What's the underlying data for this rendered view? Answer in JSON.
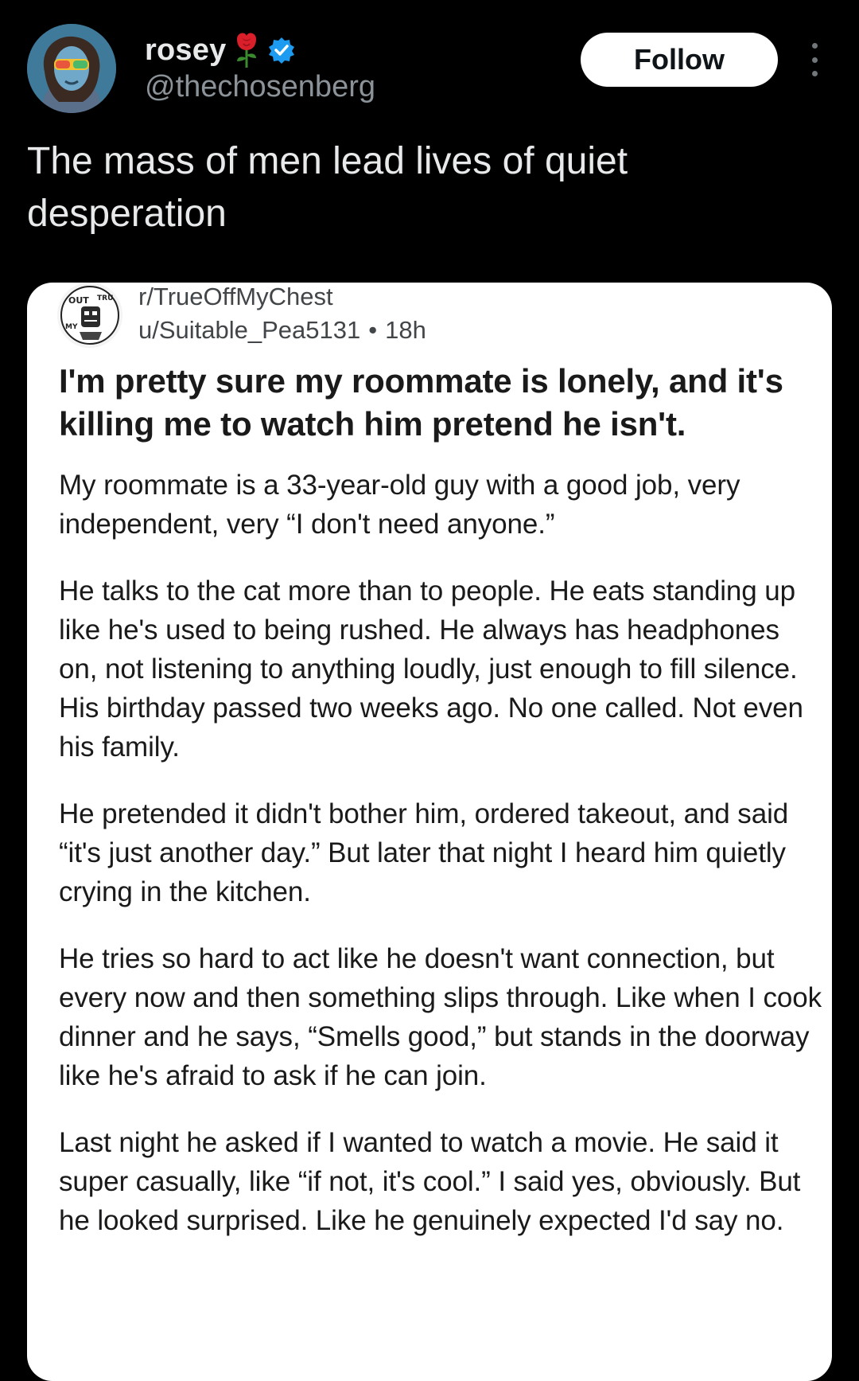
{
  "tweet": {
    "user": {
      "name": "rosey",
      "handle": "@thechosenberg",
      "name_emoji": "rose-icon",
      "verified_icon": "verified-badge-icon"
    },
    "follow_label": "Follow",
    "text": "The mass of men lead lives of quiet desperation"
  },
  "reddit_post": {
    "subreddit": "r/TrueOffMyChest",
    "username": "u/Suitable_Pea5131",
    "separator": "•",
    "time": "18h",
    "title": "I'm pretty sure my roommate is lonely, and it's killing me to watch him pretend he isn't.",
    "paragraphs": [
      "My roommate is a 33-year-old guy with a good job, very independent, very “I don't need anyone.”",
      "He talks to the cat more than to people. He eats standing up like he's used to being rushed. He always has headphones on, not listening to anything loudly, just enough to fill silence. His birthday passed two weeks ago. No one called. Not even his family.",
      "He pretended it didn't bother him, ordered takeout, and said “it's just another day.” But later that night I heard him quietly crying in the kitchen.",
      "He tries so hard to act like he doesn't want connection, but every now and then something slips through. Like when I cook dinner and he says, “Smells good,” but stands in the doorway like he's afraid to ask if he can join.",
      "Last night he asked if I wanted to watch a movie. He said it super casually, like “if not, it's cool.” I said yes, obviously. But he looked surprised. Like he genuinely expected I'd say no."
    ]
  },
  "colors": {
    "background": "#000000",
    "primary_text": "#e7e9ea",
    "secondary_text": "#8b9298",
    "verified_blue": "#1d9bf0",
    "follow_bg": "#ffffff",
    "card_bg": "#ffffff",
    "card_text": "#1a1a1b"
  }
}
